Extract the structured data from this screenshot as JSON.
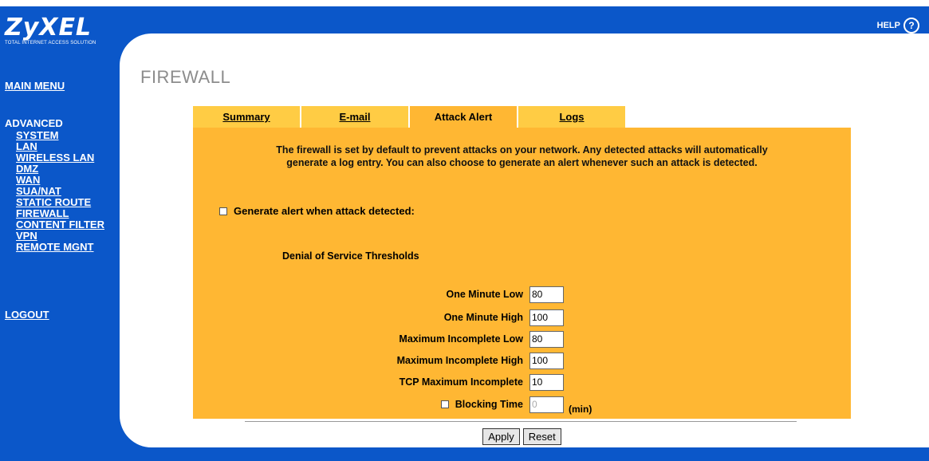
{
  "brand": {
    "name": "ZyXEL",
    "tagline": "TOTAL INTERNET ACCESS SOLUTION"
  },
  "help": {
    "label": "HELP",
    "icon": "question-circle-icon"
  },
  "sidebar": {
    "main_menu": "MAIN MENU",
    "advanced_heading": "ADVANCED",
    "items": [
      {
        "label": "SYSTEM"
      },
      {
        "label": "LAN"
      },
      {
        "label": "WIRELESS LAN"
      },
      {
        "label": "DMZ"
      },
      {
        "label": "WAN"
      },
      {
        "label": "SUA/NAT"
      },
      {
        "label": "STATIC ROUTE"
      },
      {
        "label": "FIREWALL"
      },
      {
        "label": "CONTENT FILTER"
      },
      {
        "label": "VPN"
      },
      {
        "label": "REMOTE MGNT"
      }
    ],
    "logout": "LOGOUT"
  },
  "page_title": "FIREWALL",
  "tabs": [
    {
      "label": "Summary",
      "active": false
    },
    {
      "label": "E-mail",
      "active": false
    },
    {
      "label": "Attack Alert",
      "active": true
    },
    {
      "label": "Logs",
      "active": false
    }
  ],
  "content": {
    "description_line1": "The firewall is set by default to prevent attacks on your network. Any detected attacks will automatically",
    "description_line2": "generate a log entry. You can also choose to generate an alert whenever such an attack is detected.",
    "alert_checkbox_label": "Generate alert when attack detected:",
    "alert_checked": false,
    "dos_heading": "Denial of Service Thresholds",
    "thresholds": [
      {
        "label": "One Minute Low",
        "value": "80"
      },
      {
        "label": "One Minute High",
        "value": "100"
      },
      {
        "label": "Maximum Incomplete Low",
        "value": "80"
      },
      {
        "label": "Maximum Incomplete High",
        "value": "100"
      },
      {
        "label": "TCP Maximum Incomplete",
        "value": "10"
      }
    ],
    "blocking_time_label": "Blocking Time",
    "blocking_time_checked": false,
    "blocking_time_value": "0",
    "blocking_time_unit": "(min)",
    "apply_label": "Apply",
    "reset_label": "Reset"
  },
  "colors": {
    "frame_blue": "#0b57c9",
    "tab_bg": "#ffcc44",
    "content_bg": "#ffb733",
    "title_gray": "#8c8c8c"
  }
}
